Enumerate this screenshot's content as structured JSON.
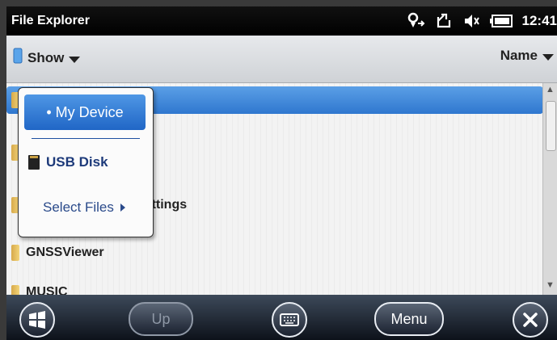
{
  "titlebar": {
    "title": "File Explorer",
    "time": "12:41"
  },
  "toolbar": {
    "show_label": "Show",
    "sort_label": "Name"
  },
  "file_list": {
    "items": [
      {
        "label": "",
        "selected": true
      },
      {
        "label": "",
        "selected": false
      },
      {
        "label": "Settings",
        "selected": false
      },
      {
        "label": "GNSSViewer",
        "selected": false
      },
      {
        "label": "MUSIC",
        "selected": false
      }
    ]
  },
  "popup_menu": {
    "my_device": "• My Device",
    "usb_disk": "USB Disk",
    "select_files": "Select Files"
  },
  "bottombar": {
    "up_label": "Up",
    "menu_label": "Menu"
  },
  "colors": {
    "accent": "#2f77cf",
    "menu_text": "#1d3a7a"
  }
}
